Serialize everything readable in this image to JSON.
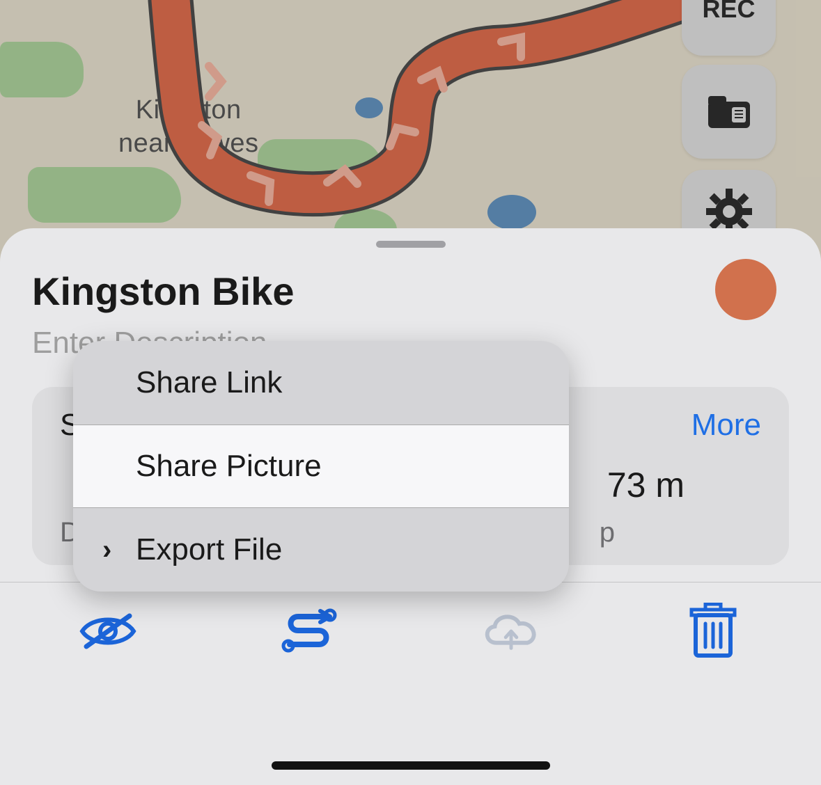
{
  "map": {
    "label_line1": "Kingston",
    "label_line2": "near Lewes"
  },
  "side_buttons": {
    "rec_label": "REC"
  },
  "sheet": {
    "title": "Kingston Bike",
    "description_placeholder": "Enter Description",
    "track_color": "#d1714d",
    "stats": {
      "heading": "S",
      "more_label": "More",
      "value": "73 m",
      "sub_left": "D",
      "sub_right": "p"
    }
  },
  "popup": {
    "items": [
      {
        "label": "Share Link",
        "has_chevron": false
      },
      {
        "label": "Share Picture",
        "has_chevron": false
      },
      {
        "label": "Export File",
        "has_chevron": true
      }
    ]
  },
  "toolbar": {
    "icons": [
      "hide",
      "route",
      "cloud-upload",
      "delete"
    ]
  }
}
